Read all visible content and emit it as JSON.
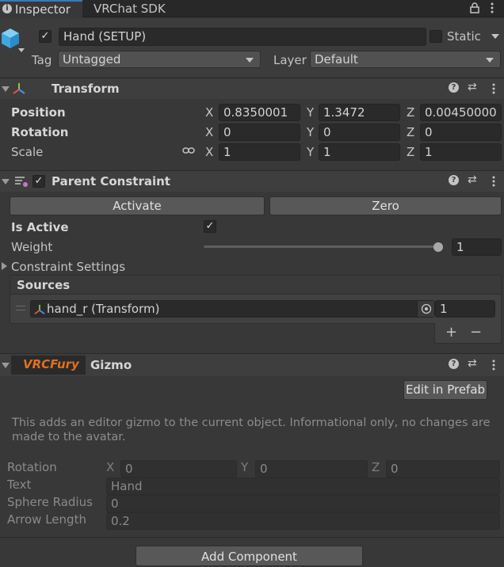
{
  "tabs": {
    "inspector": "Inspector",
    "vrchat_sdk": "VRChat SDK"
  },
  "gameobject": {
    "name": "Hand (SETUP)",
    "static_label": "Static",
    "tag_label": "Tag",
    "tag_value": "Untagged",
    "layer_label": "Layer",
    "layer_value": "Default"
  },
  "transform": {
    "title": "Transform",
    "position_label": "Position",
    "rotation_label": "Rotation",
    "scale_label": "Scale",
    "axis_x": "X",
    "axis_y": "Y",
    "axis_z": "Z",
    "position": {
      "x": "0.8350001",
      "y": "1.3472",
      "z": "0.00450000"
    },
    "rotation": {
      "x": "0",
      "y": "0",
      "z": "0"
    },
    "scale": {
      "x": "1",
      "y": "1",
      "z": "1"
    }
  },
  "parent_constraint": {
    "title": "Parent Constraint",
    "activate_label": "Activate",
    "zero_label": "Zero",
    "is_active_label": "Is Active",
    "weight_label": "Weight",
    "weight_value": "1",
    "weight_fraction": 1.0,
    "constraint_settings_label": "Constraint Settings",
    "sources_label": "Sources",
    "source_name": "hand_r (Transform)",
    "source_weight": "1",
    "plus_label": "+",
    "minus_label": "−"
  },
  "vrcfury": {
    "badge": "VRCFury",
    "title": "Gizmo",
    "edit_prefab_label": "Edit in Prefab",
    "info_text": "This adds an editor gizmo to the current object. Informational only, no changes are made to the avatar.",
    "rotation_label": "Rotation",
    "rotation": {
      "x": "0",
      "y": "0",
      "z": "0"
    },
    "text_label": "Text",
    "text_value": "Hand",
    "sphere_radius_label": "Sphere Radius",
    "sphere_radius_value": "0",
    "arrow_length_label": "Arrow Length",
    "arrow_length_value": "0.2",
    "badge_color": "#e07020"
  },
  "add_component_label": "Add Component"
}
